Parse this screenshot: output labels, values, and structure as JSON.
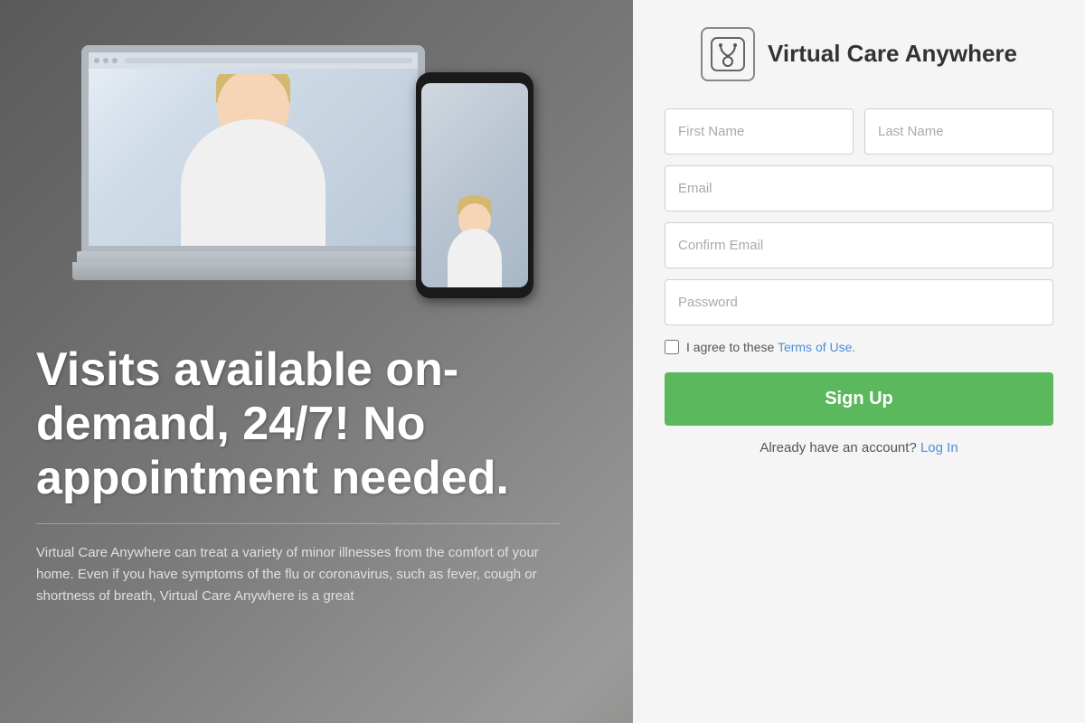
{
  "app": {
    "name": "Virtual Care Anywhere",
    "logo_icon": "🩺"
  },
  "background": {
    "color": "#6b6b6b"
  },
  "left": {
    "headline": "Visits available on-demand, 24/7! No appointment needed.",
    "description": "Virtual Care Anywhere can treat a variety of minor illnesses from the comfort of your home. Even if you have symptoms of the flu or coronavirus, such as fever, cough or shortness of breath, Virtual Care Anywhere is a great"
  },
  "form": {
    "title": "Virtual Care Anywhere",
    "fields": {
      "first_name_placeholder": "First Name",
      "last_name_placeholder": "Last Name",
      "email_placeholder": "Email",
      "confirm_email_placeholder": "Confirm Email",
      "password_placeholder": "Password"
    },
    "terms_prefix": "I agree to these ",
    "terms_link_text": "Terms of Use.",
    "signup_button": "Sign Up",
    "login_text": "Already have an account?",
    "login_link": "Log In"
  }
}
